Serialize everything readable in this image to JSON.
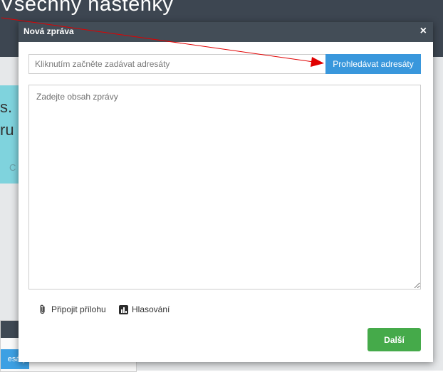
{
  "background": {
    "page_title": "Všechny nástěnky",
    "card_text_1": "s.",
    "card_text_2": "ru",
    "card_text_3": "C"
  },
  "second_dialog": {
    "close_glyph": "×",
    "button_label": "esáty"
  },
  "modal": {
    "title": "Nová zpráva",
    "close_glyph": "×",
    "recipients_placeholder": "Kliknutím začněte zadávat adresáty",
    "recipients_value": "",
    "search_button": "Prohledávat adresáty",
    "body_placeholder": "Zadejte obsah zprávy",
    "body_value": "",
    "attach_label": "Připojit přílohu",
    "attach_icon": "paperclip-icon",
    "poll_label": "Hlasování",
    "poll_icon": "bar-chart-icon",
    "next_button": "Další"
  },
  "colors": {
    "header": "#434d57",
    "primary": "#3997dc",
    "success": "#45aa4a",
    "annotation": "#e00000"
  }
}
